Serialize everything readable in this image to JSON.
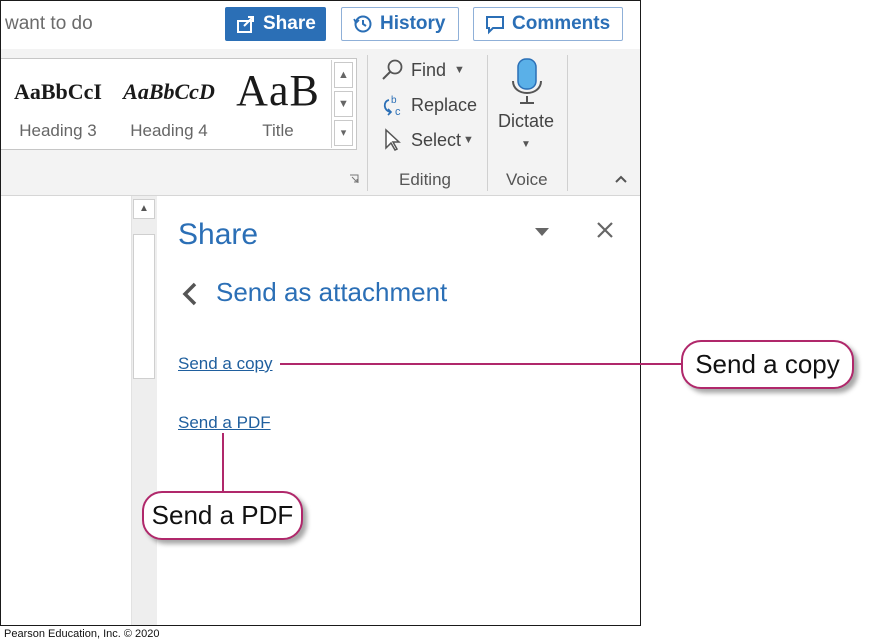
{
  "topbar": {
    "tell_me_text": "want to do",
    "share_label": "Share",
    "history_label": "History",
    "comments_label": "Comments"
  },
  "ribbon": {
    "styles": [
      {
        "sample": "AaBbCcI",
        "name": "Heading 3"
      },
      {
        "sample": "AaBbCcD",
        "name": "Heading 4"
      },
      {
        "sample": "AaB",
        "name": "Title"
      }
    ],
    "editing": {
      "find": "Find",
      "replace": "Replace",
      "select": "Select",
      "group_label": "Editing"
    },
    "voice": {
      "dictate": "Dictate",
      "group_label": "Voice"
    }
  },
  "share_pane": {
    "title": "Share",
    "subtitle": "Send as attachment",
    "send_copy_link": "Send a copy",
    "send_pdf_link": "Send a PDF"
  },
  "callouts": {
    "send_copy": "Send a copy",
    "send_pdf": "Send a PDF"
  },
  "footer": {
    "copyright": "Pearson Education, Inc. © 2020"
  },
  "colors": {
    "accent_blue": "#2b6fb6",
    "callout_magenta": "#b0286b"
  }
}
